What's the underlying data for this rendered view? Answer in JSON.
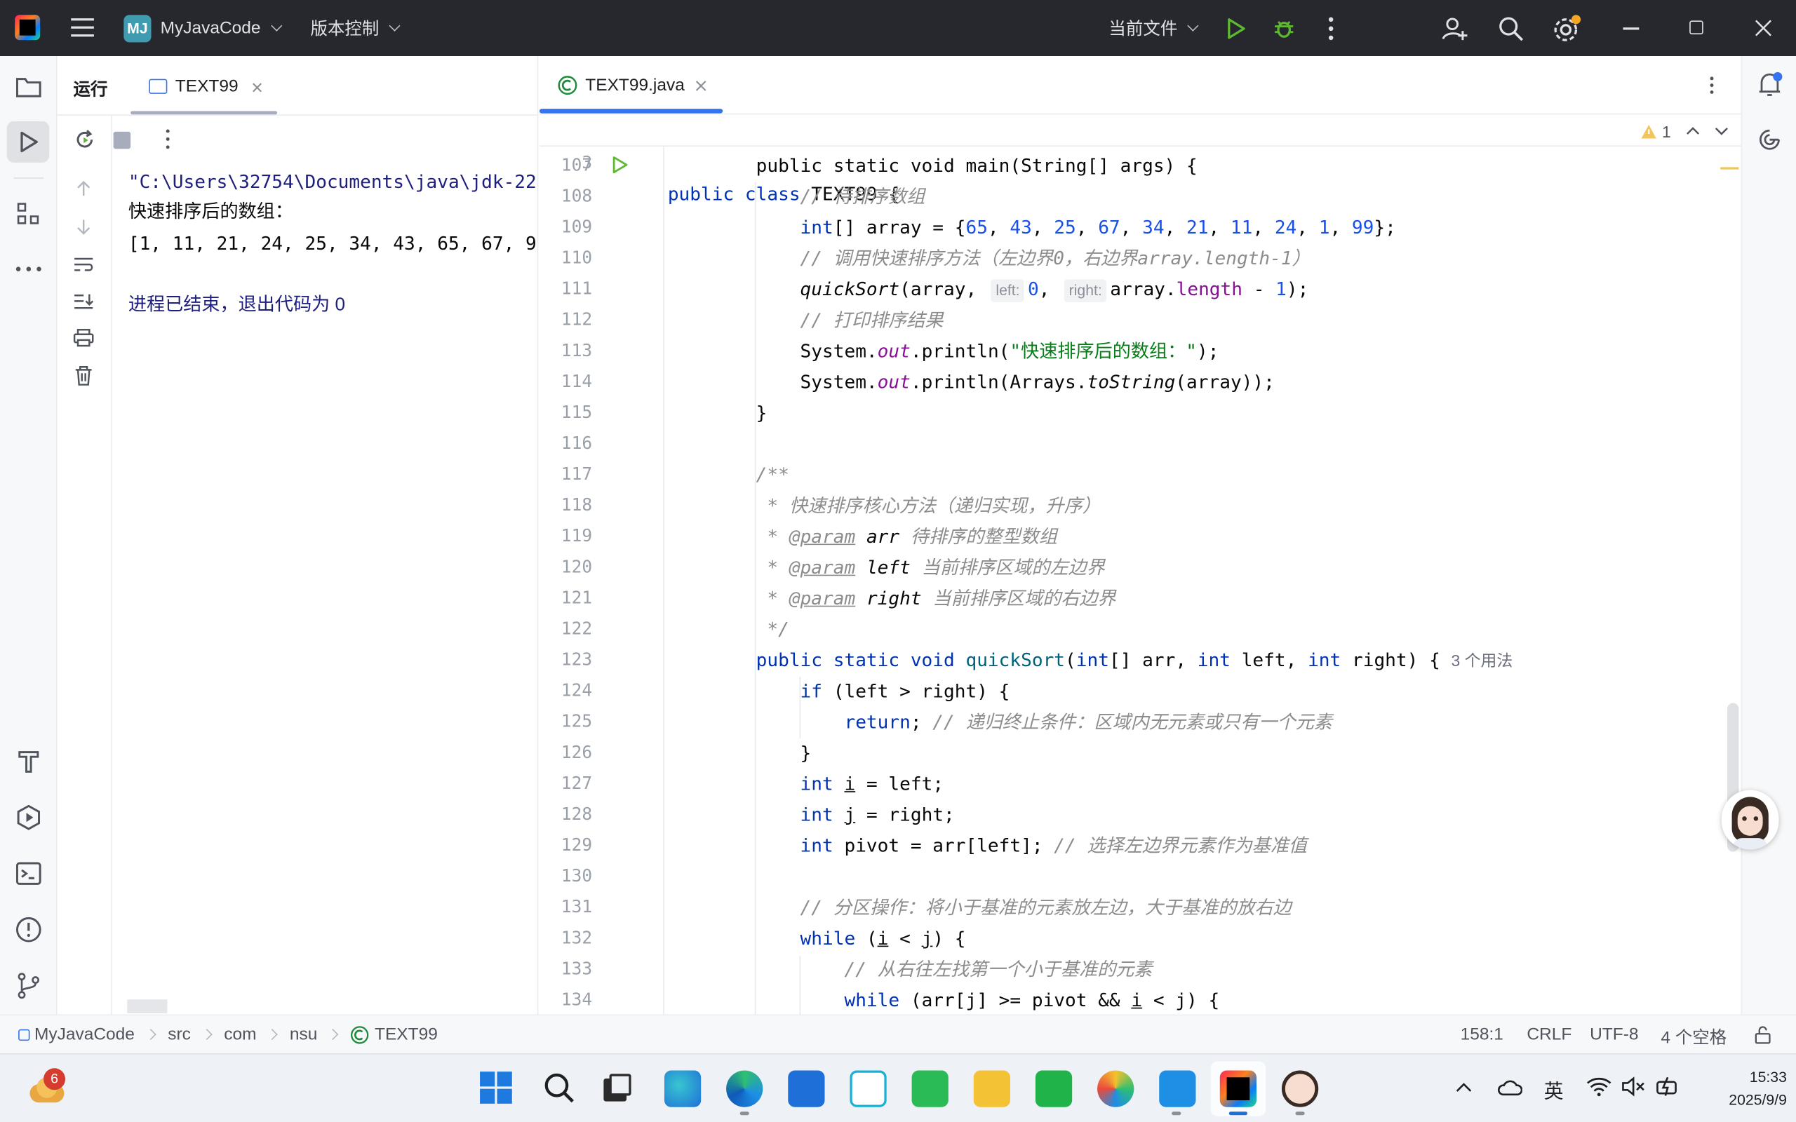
{
  "titlebar": {
    "project_badge": "MJ",
    "project_name": "MyJavaCode",
    "vcs_label": "版本控制",
    "run_config": "当前文件"
  },
  "run_panel": {
    "tab_run": "运行",
    "tab_text99": "TEXT99",
    "console": {
      "cmd_line": "\"C:\\Users\\32754\\Documents\\java\\jdk-22",
      "output_label": "快速排序后的数组：",
      "output_array": "[1, 11, 21, 24, 25, 34, 43, 65, 67, 9",
      "exit_message": "进程已结束，退出代码为 0"
    }
  },
  "editor": {
    "tab_label": "TEXT99.java",
    "sticky": {
      "line": "3",
      "text": "public class TEXT99 {"
    },
    "warning_count": "1",
    "usages_hint": "3 个用法",
    "hint_left": "left:",
    "hint_right": "right:",
    "lines": {
      "107": "public static void main(String[] args) {",
      "108": "// 待排序数组",
      "110": "// 调用快速排序方法（左边界0，右边界array.length-1）",
      "112": "// 打印排序结果",
      "113_str": "\"快速排序后的数组：\"",
      "117": "/**",
      "118": " * 快速排序核心方法（递归实现，升序）",
      "119_desc": "待排序的整型数组",
      "120_desc": "当前排序区域的左边界",
      "121_desc": "当前排序区域的右边界",
      "122": " */",
      "125_cmt": "// 递归终止条件：区域内无元素或只有一个元素",
      "129_cmt": "// 选择左边界元素作为基准值",
      "131": "// 分区操作：将小于基准的元素放左边，大于基准的放右边",
      "133": "// 从右往左找第一个小于基准的元素"
    },
    "line_numbers": [
      "107",
      "108",
      "109",
      "110",
      "111",
      "112",
      "113",
      "114",
      "115",
      "116",
      "117",
      "118",
      "119",
      "120",
      "121",
      "122",
      "123",
      "124",
      "125",
      "126",
      "127",
      "128",
      "129",
      "130",
      "131",
      "132",
      "133",
      "134"
    ]
  },
  "statusbar": {
    "breadcrumb": [
      "MyJavaCode",
      "src",
      "com",
      "nsu",
      "TEXT99"
    ],
    "position": "158:1",
    "line_sep": "CRLF",
    "encoding": "UTF-8",
    "indent": "4 个空格"
  },
  "taskbar": {
    "weather_badge": "6",
    "clock_time": "15:33",
    "clock_date": "2025/9/9",
    "ime": "英"
  },
  "colors": {
    "titlebar_bg": "#27282e",
    "keyword": "#0033b3",
    "number": "#1750eb",
    "string": "#067d17",
    "comment": "#8c8c8c",
    "run_green": "#5fb832",
    "accent_blue": "#3574f0"
  }
}
